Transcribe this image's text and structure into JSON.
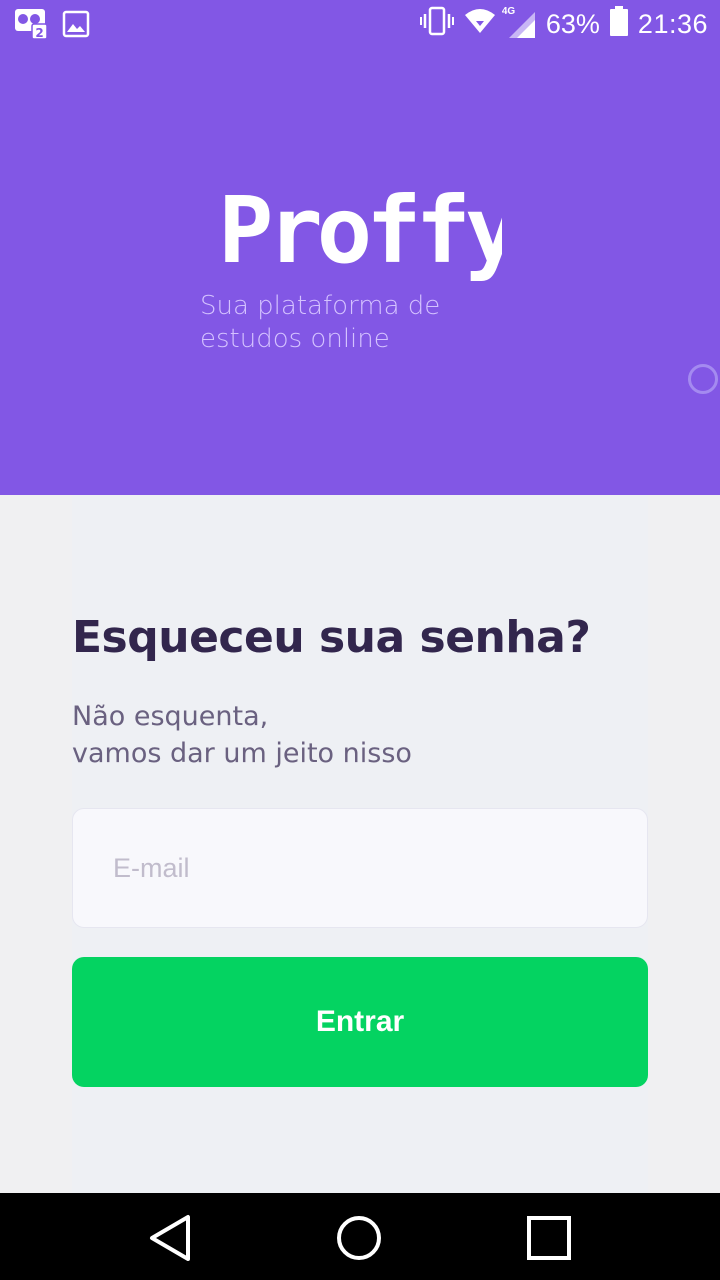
{
  "status_bar": {
    "battery_percent": "63%",
    "time": "21:36",
    "network_label": "4G",
    "icons": [
      "notification-badge-icon",
      "image-icon",
      "vibrate-icon",
      "wifi-icon",
      "signal-icon",
      "battery-icon"
    ]
  },
  "header": {
    "logo_text": "Proffy",
    "tagline_line1": "Sua plataforma de",
    "tagline_line2": "estudos online"
  },
  "form": {
    "title": "Esqueceu sua senha?",
    "subtitle_line1": "Não esquenta,",
    "subtitle_line2": "vamos dar um jeito nisso",
    "email_placeholder": "E-mail",
    "email_value": "",
    "submit_label": "Entrar"
  },
  "nav_bar": {
    "buttons": [
      "back-icon",
      "home-icon",
      "recents-icon"
    ]
  },
  "colors": {
    "primary": "#8257e5",
    "button": "#04d361",
    "title": "#32264d",
    "background": "#f0f0f2"
  }
}
